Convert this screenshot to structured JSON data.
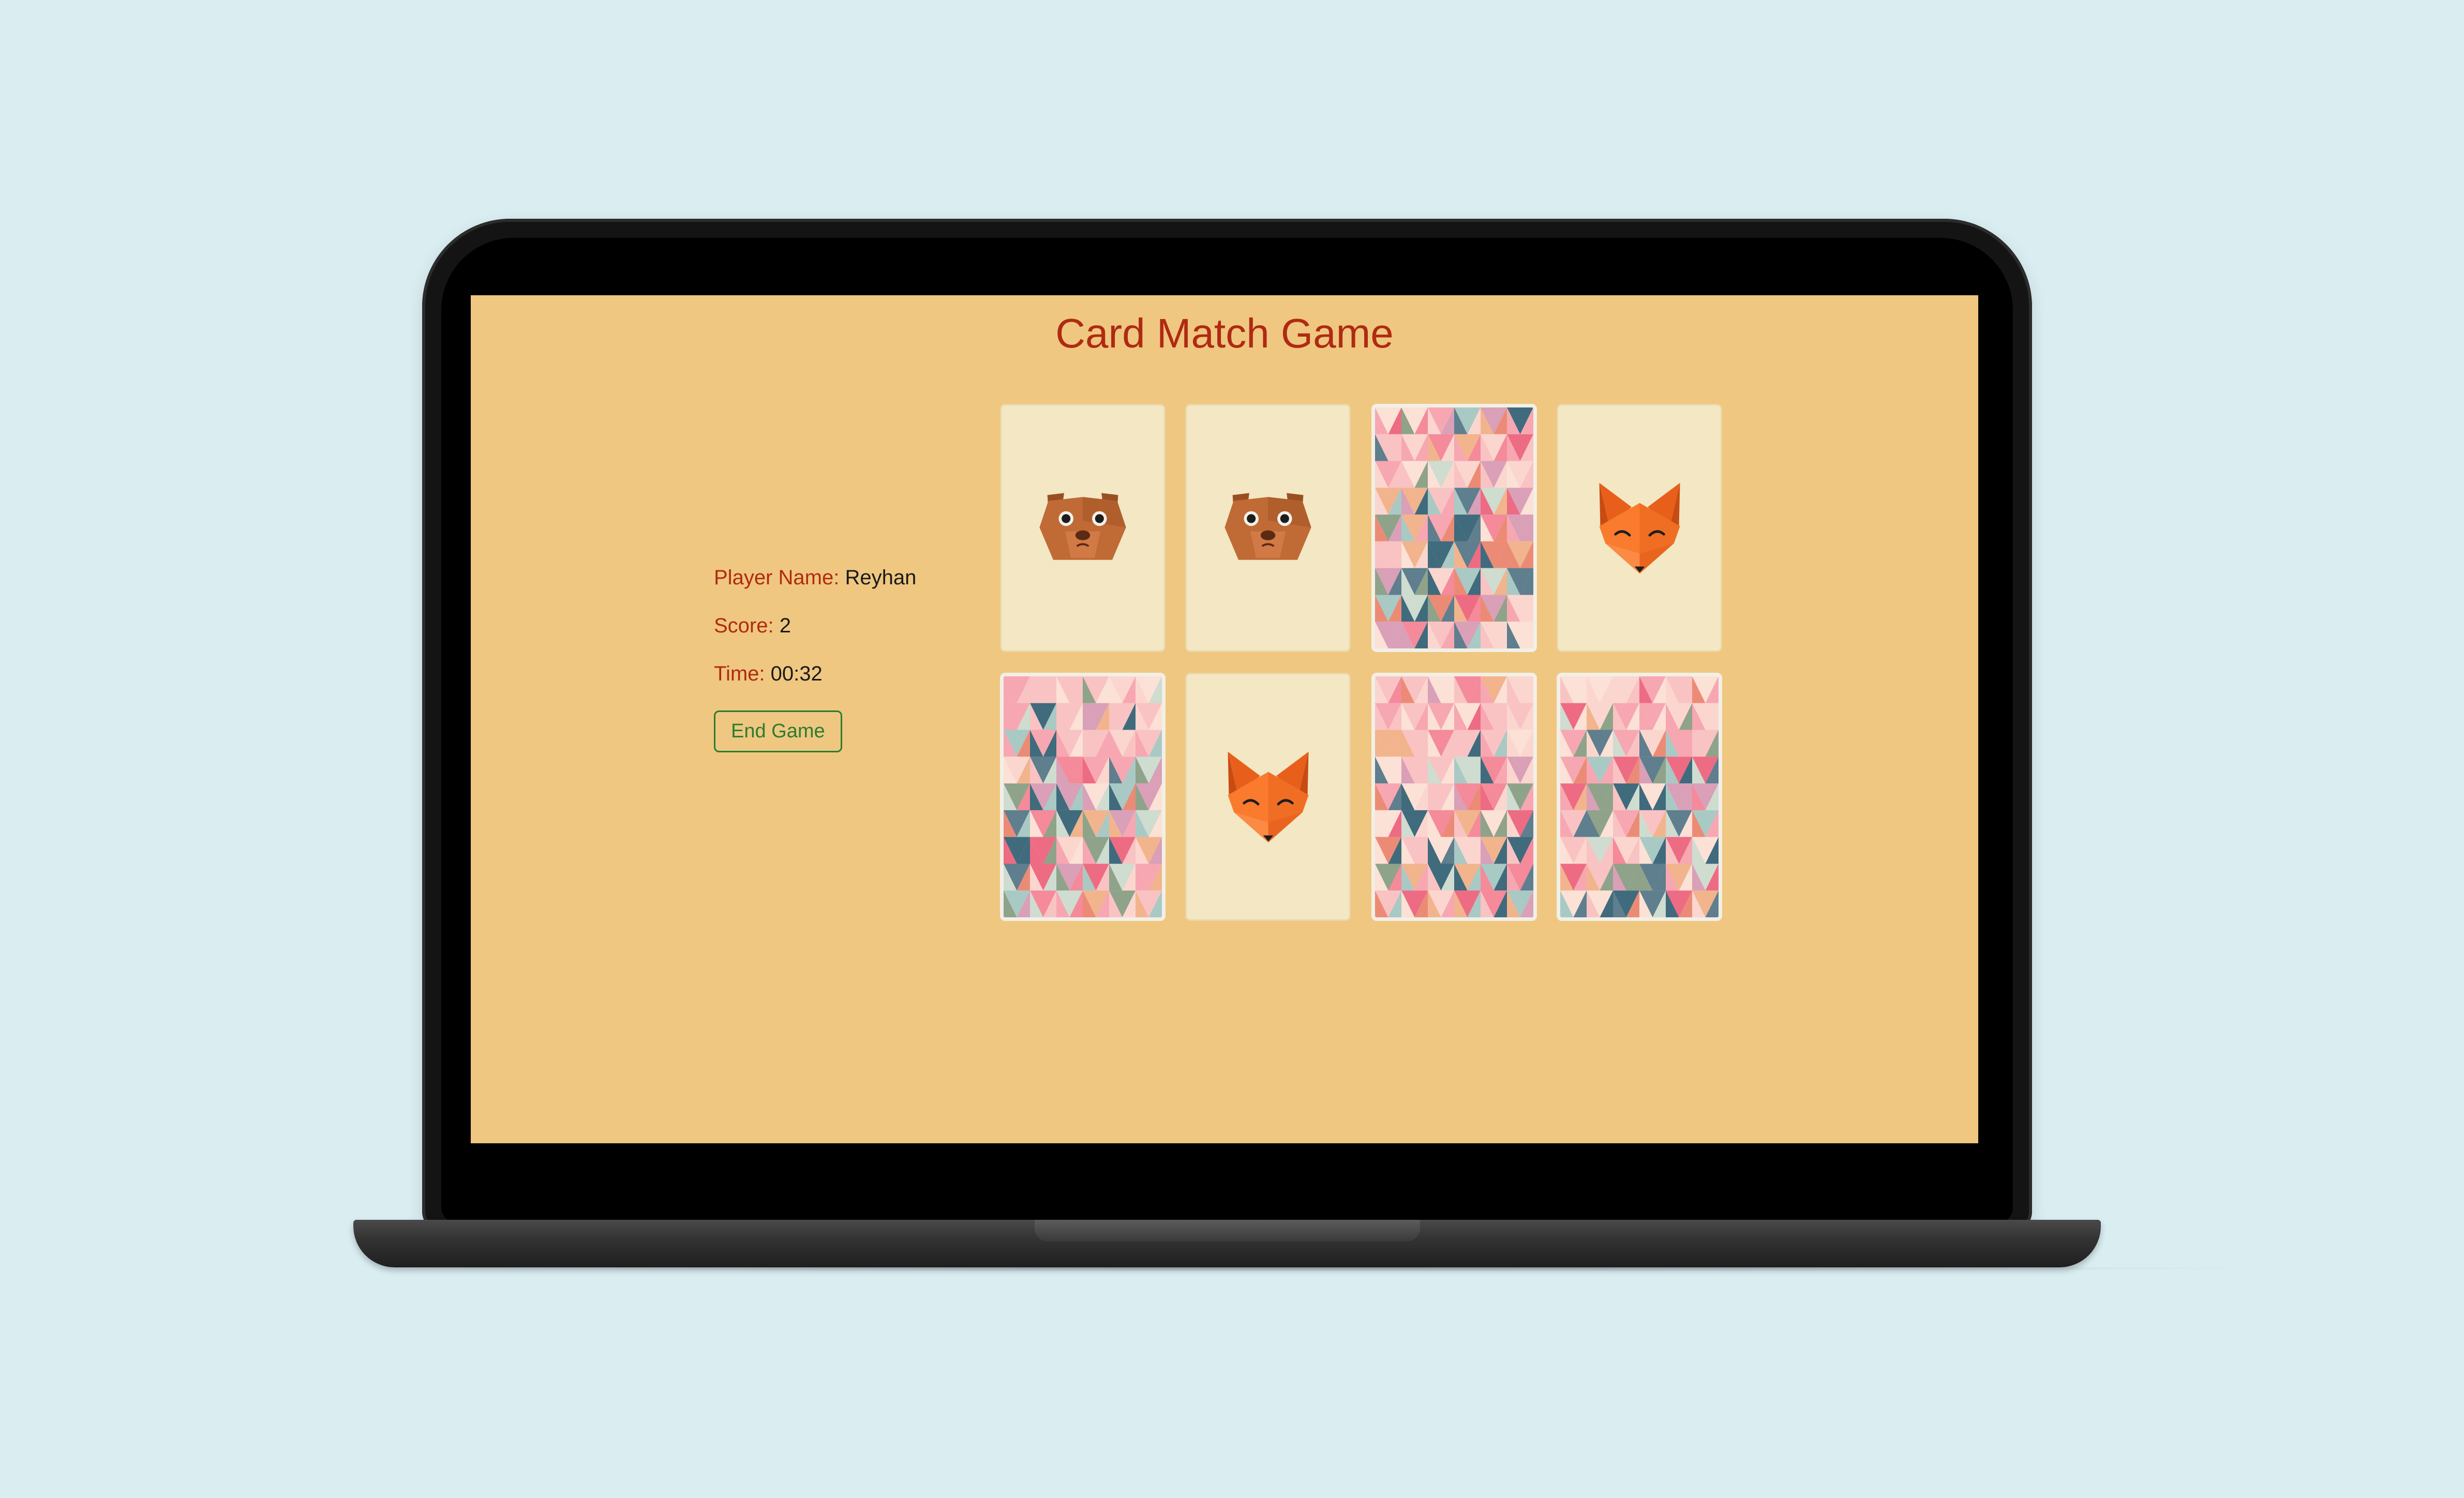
{
  "game": {
    "title": "Card Match Game"
  },
  "player": {
    "name_label": "Player Name:",
    "name_value": "Reyhan",
    "score_label": "Score:",
    "score_value": "2",
    "time_label": "Time:",
    "time_value": "00:32",
    "end_button_label": "End Game"
  },
  "cards": [
    {
      "state": "face-up",
      "animal": "bear"
    },
    {
      "state": "face-up",
      "animal": "bear"
    },
    {
      "state": "face-down"
    },
    {
      "state": "face-up",
      "animal": "fox"
    },
    {
      "state": "face-down"
    },
    {
      "state": "face-up",
      "animal": "fox"
    },
    {
      "state": "face-down"
    },
    {
      "state": "face-down"
    }
  ],
  "colors": {
    "background": "#daeef2",
    "screen": "#efc780",
    "accent_red": "#b02a12",
    "button_green": "#2b7d30",
    "card_face": "#f3e7c4"
  }
}
